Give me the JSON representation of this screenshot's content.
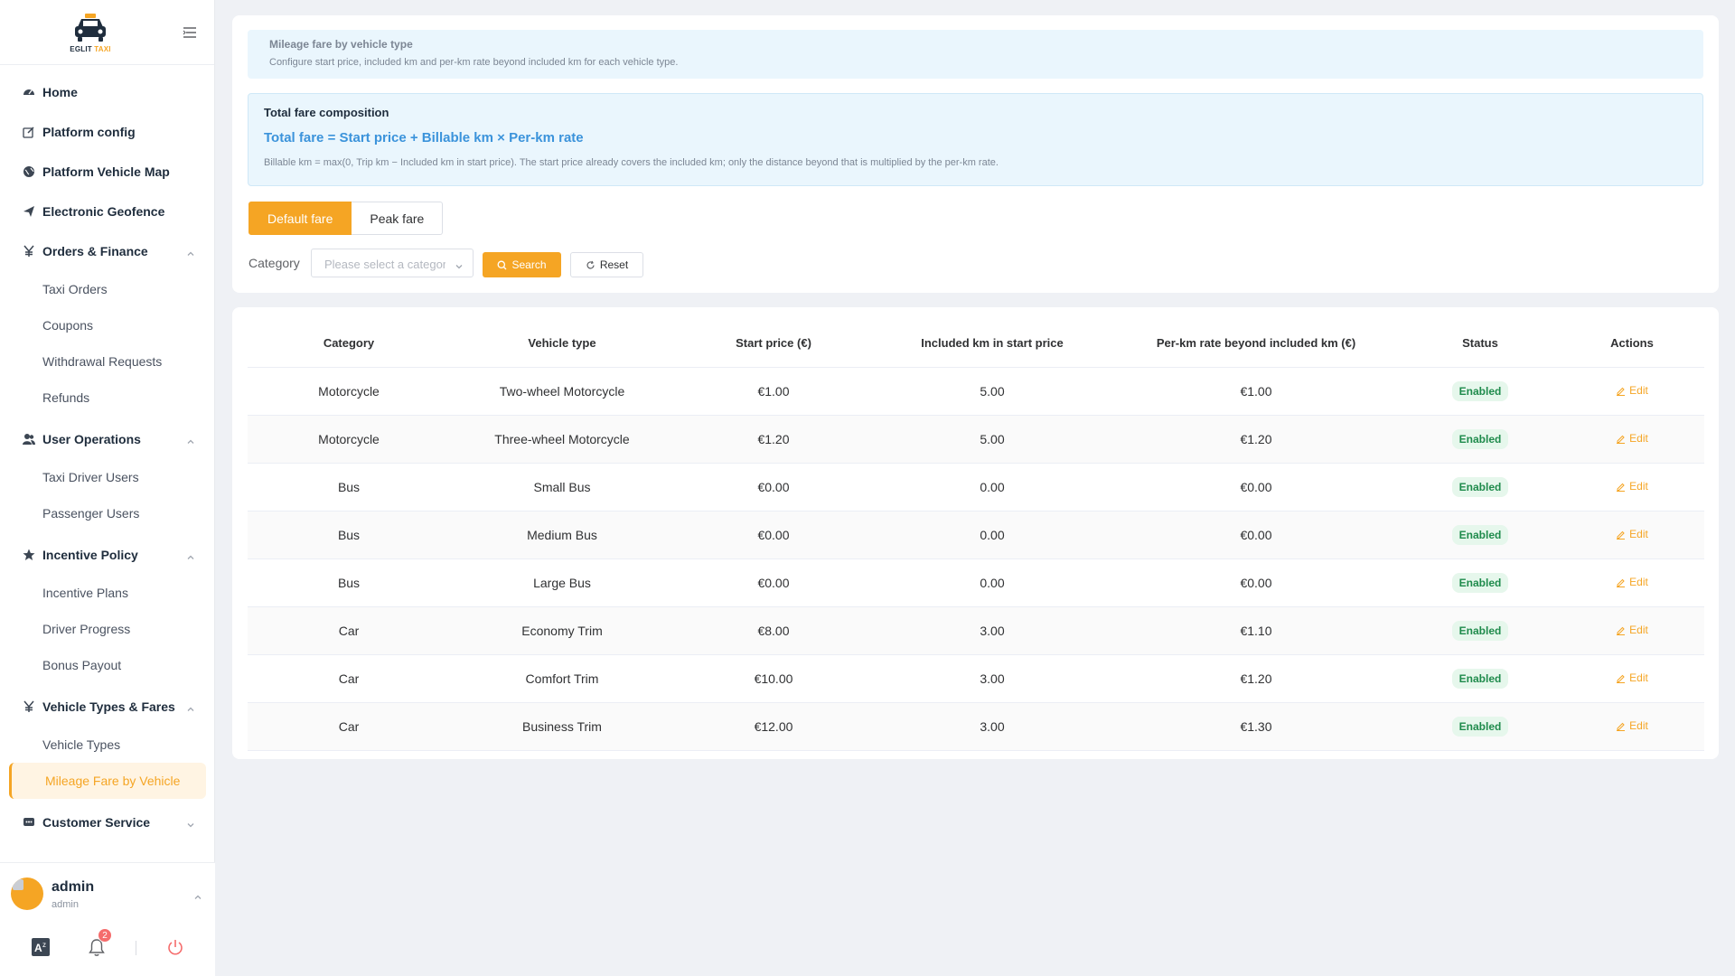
{
  "brand": {
    "name_part1": "EGLIT",
    "name_part2": "TAXI"
  },
  "sidebar": {
    "menu": [
      {
        "type": "item",
        "label": "Home",
        "icon": "dashboard-icon",
        "name": "menu-home"
      },
      {
        "type": "item",
        "label": "Platform config",
        "icon": "edit-icon",
        "name": "menu-platform-config"
      },
      {
        "type": "item",
        "label": "Platform Vehicle Map",
        "icon": "globe-icon",
        "name": "menu-platform-vehicle-map"
      },
      {
        "type": "item",
        "label": "Electronic Geofence",
        "icon": "send-icon",
        "name": "menu-electronic-geofence"
      },
      {
        "type": "group",
        "label": "Orders & Finance",
        "icon": "yen-icon",
        "name": "menu-orders-finance",
        "expanded": true,
        "children": [
          "Taxi Orders",
          "Coupons",
          "Withdrawal Requests",
          "Refunds"
        ]
      },
      {
        "type": "group",
        "label": "User Operations",
        "icon": "users-icon",
        "name": "menu-user-operations",
        "expanded": true,
        "children": [
          "Taxi Driver Users",
          "Passenger Users"
        ]
      },
      {
        "type": "group",
        "label": "Incentive Policy",
        "icon": "star-icon",
        "name": "menu-incentive-policy",
        "expanded": true,
        "children": [
          "Incentive Plans",
          "Driver Progress",
          "Bonus Payout"
        ]
      },
      {
        "type": "group",
        "label": "Vehicle Types & Fares",
        "icon": "yen-icon",
        "name": "menu-vehicle-types-fares",
        "expanded": true,
        "children": [
          "Vehicle Types",
          "Mileage Fare by Vehicle"
        ],
        "active_child": "Mileage Fare by Vehicle"
      },
      {
        "type": "group",
        "label": "Customer Service",
        "icon": "chat-icon",
        "name": "menu-customer-service",
        "expanded": false,
        "children": []
      }
    ],
    "user": {
      "name": "admin",
      "role": "admin"
    },
    "notifications_count": "2"
  },
  "info": {
    "title": "Mileage fare by vehicle type",
    "description": "Configure start price, included km and per-km rate beyond included km for each vehicle type."
  },
  "formula": {
    "title": "Total fare composition",
    "main": "Total fare = Start price + Billable km × Per-km rate",
    "note": "Billable km = max(0, Trip km − Included km in start price). The start price already covers the included km; only the distance beyond that is multiplied by the per-km rate."
  },
  "tabs": {
    "default_label": "Default fare",
    "peak_label": "Peak fare",
    "active": "Default fare"
  },
  "filter": {
    "label": "Category",
    "placeholder": "Please select a category",
    "search_label": "Search",
    "reset_label": "Reset"
  },
  "table": {
    "headers": [
      "Category",
      "Vehicle type",
      "Start price (€)",
      "Included km in start price",
      "Per-km rate beyond included km (€)",
      "Status",
      "Actions"
    ],
    "rows": [
      {
        "category": "Motorcycle",
        "vehicle_type": "Two-wheel Motorcycle",
        "start_price": "€1.00",
        "included_km": "5.00",
        "per_km": "€1.00",
        "status": "Enabled",
        "action": "Edit"
      },
      {
        "category": "Motorcycle",
        "vehicle_type": "Three-wheel Motorcycle",
        "start_price": "€1.20",
        "included_km": "5.00",
        "per_km": "€1.20",
        "status": "Enabled",
        "action": "Edit"
      },
      {
        "category": "Bus",
        "vehicle_type": "Small Bus",
        "start_price": "€0.00",
        "included_km": "0.00",
        "per_km": "€0.00",
        "status": "Enabled",
        "action": "Edit"
      },
      {
        "category": "Bus",
        "vehicle_type": "Medium Bus",
        "start_price": "€0.00",
        "included_km": "0.00",
        "per_km": "€0.00",
        "status": "Enabled",
        "action": "Edit"
      },
      {
        "category": "Bus",
        "vehicle_type": "Large Bus",
        "start_price": "€0.00",
        "included_km": "0.00",
        "per_km": "€0.00",
        "status": "Enabled",
        "action": "Edit"
      },
      {
        "category": "Car",
        "vehicle_type": "Economy Trim",
        "start_price": "€8.00",
        "included_km": "3.00",
        "per_km": "€1.10",
        "status": "Enabled",
        "action": "Edit"
      },
      {
        "category": "Car",
        "vehicle_type": "Comfort Trim",
        "start_price": "€10.00",
        "included_km": "3.00",
        "per_km": "€1.20",
        "status": "Enabled",
        "action": "Edit"
      },
      {
        "category": "Car",
        "vehicle_type": "Business Trim",
        "start_price": "€12.00",
        "included_km": "3.00",
        "per_km": "€1.30",
        "status": "Enabled",
        "action": "Edit"
      }
    ]
  },
  "colors": {
    "accent": "#f5a524",
    "formula_blue": "#3b93db",
    "status_green": "#1f8b4c"
  }
}
